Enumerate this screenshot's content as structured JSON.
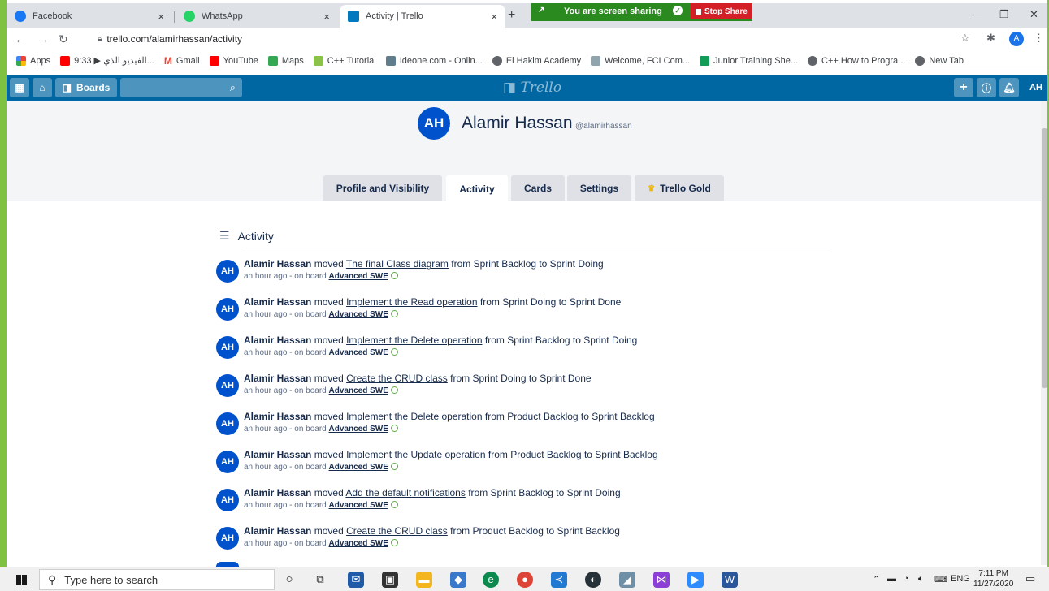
{
  "browser": {
    "tabs": [
      {
        "title": "Facebook",
        "icon": "facebook-icon",
        "color": "#1877f2",
        "active": false
      },
      {
        "title": "WhatsApp",
        "icon": "whatsapp-icon",
        "color": "#25d366",
        "active": false
      },
      {
        "title": "Activity | Trello",
        "icon": "trello-icon",
        "color": "#0079bf",
        "active": true
      }
    ],
    "new_tab_glyph": "+",
    "close_glyph": "×",
    "window_controls": {
      "minimize": "—",
      "maximize": "❐",
      "close": "✕"
    },
    "url": "trello.com/alamirhassan/activity",
    "profile_initial": "A"
  },
  "screen_share": {
    "message": "You are screen sharing",
    "stop_label": "Stop Share"
  },
  "bookmarks": [
    {
      "label": "Apps",
      "color": "#e8710a"
    },
    {
      "label": "",
      "color": "#ff0000"
    },
    {
      "label": "9:33 ▶ الفيديو الذي...",
      "color": "#ffffff"
    },
    {
      "label": "Gmail",
      "color": "#ea4335"
    },
    {
      "label": "YouTube",
      "color": "#ff0000"
    },
    {
      "label": "Maps",
      "color": "#34a853"
    },
    {
      "label": "C++ Tutorial",
      "color": "#8bc34a"
    },
    {
      "label": "Ideone.com - Onlin...",
      "color": "#607d8b"
    },
    {
      "label": "El Hakim Academy",
      "color": "#5f6368"
    },
    {
      "label": "Welcome, FCI Com...",
      "color": "#90a4ae"
    },
    {
      "label": "Junior Training She...",
      "color": "#0f9d58"
    },
    {
      "label": "C++ How to Progra...",
      "color": "#5f6368"
    },
    {
      "label": "New Tab",
      "color": "#5f6368"
    }
  ],
  "trello_header": {
    "boards_label": "Boards",
    "logo_text": "Trello",
    "avatar_initials": "AH",
    "brand_color": "#0067a3"
  },
  "profile": {
    "initials": "AH",
    "name": "Alamir Hassan",
    "username": "@alamirhassan",
    "tabs": [
      "Profile and Visibility",
      "Activity",
      "Cards",
      "Settings",
      "Trello Gold"
    ],
    "active_tab": "Activity"
  },
  "activity": {
    "heading": "Activity",
    "items": [
      {
        "user": "Alamir Hassan",
        "verb": "moved",
        "card": "The final Class diagram",
        "rest": "from Sprint Backlog to Sprint Doing",
        "when": "an hour ago - on board",
        "board": "Advanced SWE"
      },
      {
        "user": "Alamir Hassan",
        "verb": "moved",
        "card": "Implement the Read operation",
        "rest": "from Sprint Doing to Sprint Done",
        "when": "an hour ago - on board",
        "board": "Advanced SWE"
      },
      {
        "user": "Alamir Hassan",
        "verb": "moved",
        "card": "Implement the Delete operation",
        "rest": "from Sprint Backlog to Sprint Doing",
        "when": "an hour ago - on board",
        "board": "Advanced SWE"
      },
      {
        "user": "Alamir Hassan",
        "verb": "moved",
        "card": "Create the CRUD class",
        "rest": "from Sprint Doing to Sprint Done",
        "when": "an hour ago - on board",
        "board": "Advanced SWE"
      },
      {
        "user": "Alamir Hassan",
        "verb": "moved",
        "card": "Implement the Delete operation",
        "rest": "from Product Backlog to Sprint Backlog",
        "when": "an hour ago - on board",
        "board": "Advanced SWE"
      },
      {
        "user": "Alamir Hassan",
        "verb": "moved",
        "card": "Implement the Update operation",
        "rest": "from Product Backlog to Sprint Backlog",
        "when": "an hour ago - on board",
        "board": "Advanced SWE"
      },
      {
        "user": "Alamir Hassan",
        "verb": "moved",
        "card": "Add the default notifications",
        "rest": "from Sprint Backlog to Sprint Doing",
        "when": "an hour ago - on board",
        "board": "Advanced SWE"
      },
      {
        "user": "Alamir Hassan",
        "verb": "moved",
        "card": "Create the CRUD class",
        "rest": "from Product Backlog to Sprint Backlog",
        "when": "an hour ago - on board",
        "board": "Advanced SWE"
      }
    ]
  },
  "taskbar": {
    "search_placeholder": "Type here to search",
    "language": "ENG",
    "time": "7:11 PM",
    "date": "11/27/2020"
  }
}
